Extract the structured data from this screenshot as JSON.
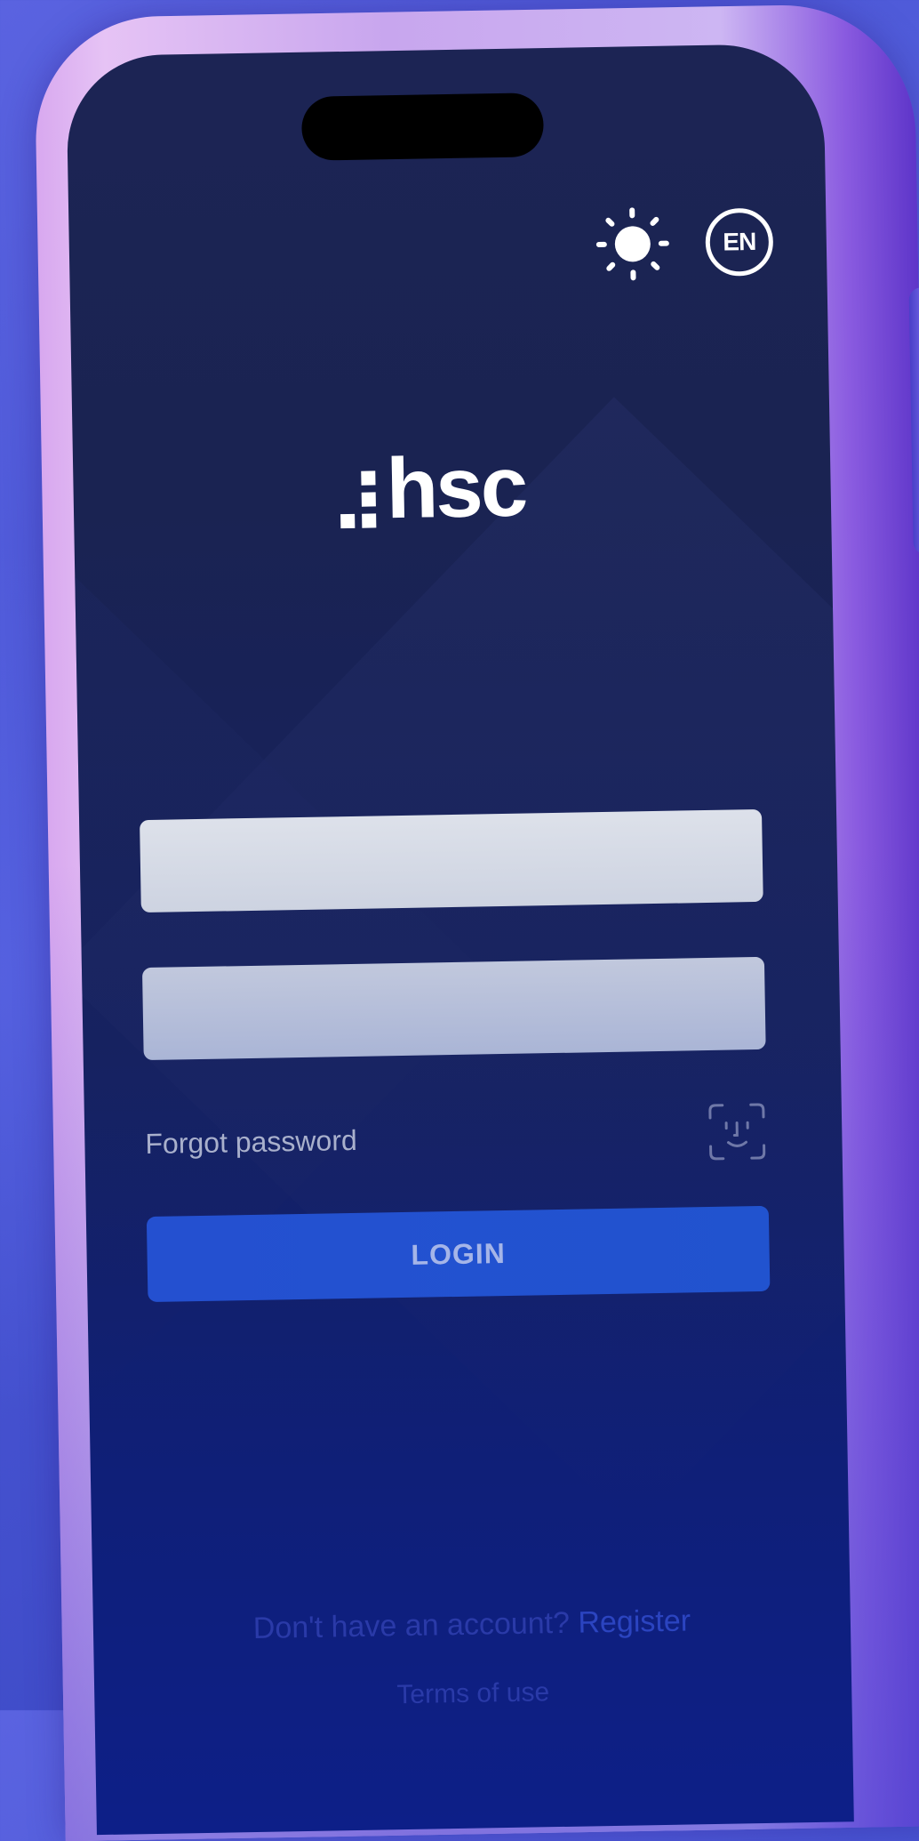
{
  "header": {
    "theme_icon": "sun-icon",
    "language_label": "EN"
  },
  "brand": {
    "logo_text": "hsc"
  },
  "form": {
    "username_value": "",
    "password_value": "",
    "forgot_password_label": "Forgot password",
    "biometric_icon": "face-id-icon",
    "login_label": "LOGIN"
  },
  "footer": {
    "register_prompt": "Don't have an account?",
    "register_link": "Register",
    "terms_label": "Terms of use"
  },
  "colors": {
    "screen_background": "#1c2454",
    "frame_accent": "#d8a8ef",
    "login_button": "#2450d0",
    "page_background": "#4a56d6"
  }
}
